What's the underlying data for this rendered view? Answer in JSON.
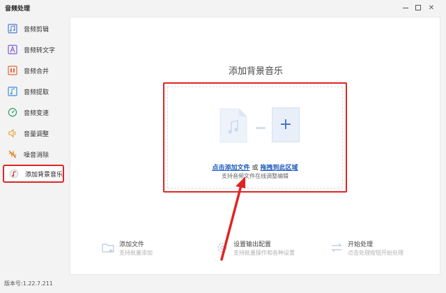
{
  "window": {
    "title": "音频处理",
    "version": "版本号:1.22.7.211"
  },
  "sidebar": {
    "items": [
      {
        "label": "音频剪辑",
        "icon": "audio-cut-icon"
      },
      {
        "label": "音频转文字",
        "icon": "audio-to-text-icon"
      },
      {
        "label": "音频合并",
        "icon": "audio-merge-icon"
      },
      {
        "label": "音频提取",
        "icon": "audio-extract-icon"
      },
      {
        "label": "音频变速",
        "icon": "audio-speed-icon"
      },
      {
        "label": "音量调整",
        "icon": "volume-icon"
      },
      {
        "label": "噪音消除",
        "icon": "noise-remove-icon"
      },
      {
        "label": "添加背景音乐",
        "icon": "background-music-icon",
        "active": true
      }
    ]
  },
  "main": {
    "title": "添加背景音乐",
    "dropzone": {
      "add_file_link": "点击添加文件",
      "or_text": "或",
      "drag_link": "拖拽到此区域",
      "hint": "支持音频文件在线调整编辑"
    }
  },
  "toolbar": {
    "add_file": {
      "title": "添加文件",
      "subtitle": "支持批量添加"
    },
    "output_settings": {
      "title": "设置输出配置",
      "subtitle": "支持批量操作和各种设置"
    },
    "start": {
      "title": "开始处理",
      "subtitle": "点击处理按钮开始处理"
    }
  },
  "colors": {
    "accent": "#1e5bbf",
    "highlight_red": "#e02424",
    "plus_bg": "#e8eff9"
  }
}
